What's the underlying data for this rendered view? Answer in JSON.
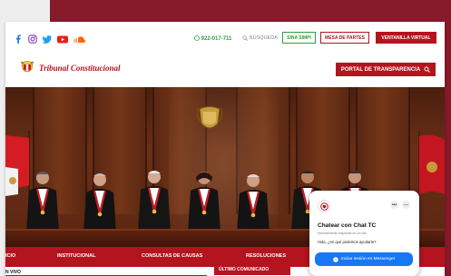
{
  "topbar": {
    "social_icons": [
      "facebook-icon",
      "instagram-icon",
      "twitter-icon",
      "youtube-icon",
      "soundcloud-icon"
    ],
    "phone": "922-017-711",
    "search_label": "BÚSQUEDA",
    "buttons": {
      "sinapsis": "SINA SIMPI",
      "mesa_partes": "MESA DE PARTES",
      "ventanilla": "VENTANILLA VIRTUAL"
    }
  },
  "header": {
    "site_title": "Tribunal Constitucional",
    "portal_button": "PORTAL DE TRANSPARENCIA"
  },
  "nav": {
    "items": [
      "ICIO",
      "INSTITUCIONAL",
      "CONSULTAS DE CAUSAS",
      "RESOLUCIONES"
    ]
  },
  "sections": {
    "left_label": "N VIVO",
    "right_label": "ÚLTIMO COMUNICADO"
  },
  "chat": {
    "title": "Chatear con Chat TC",
    "subtitle": "Normalmente responde en un día",
    "message": "Hola, ¿en qué podemos ayudarte?",
    "login_button": "Iniciar sesión en Messenger"
  },
  "colors": {
    "brand_red": "#b4141e",
    "background_maroon": "#86192a",
    "phone_green": "#2c9e3e",
    "messenger_blue": "#1877f2"
  }
}
